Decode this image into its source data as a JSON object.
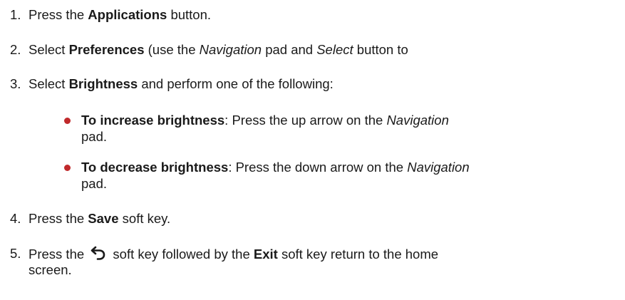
{
  "accent_color": "#c0292b",
  "steps": [
    {
      "number": "1.",
      "pre": "Press the ",
      "bold": "Applications",
      "post": " button."
    },
    {
      "number": "2.",
      "pre": "Select ",
      "bold": "Preferences",
      "mid": " (use the ",
      "ital1": "Navigation",
      "mid2": " pad and ",
      "ital2": "Select",
      "post": " button to"
    },
    {
      "number": "3.",
      "pre": "Select ",
      "bold": "Brightness",
      "post": " and perform one of the following:"
    },
    {
      "number": "4.",
      "pre": "Press the ",
      "bold": "Save",
      "post": " soft key."
    },
    {
      "number": "5.",
      "pre": "Press the ",
      "icon": "back-arrow-icon",
      "mid": " soft key followed by the ",
      "bold": "Exit",
      "post": " soft key return to the home",
      "cont": "screen."
    }
  ],
  "bullets": [
    {
      "bold": "To increase brightness",
      "text": ": Press the up arrow on the ",
      "ital": "Navigation",
      "cont": "pad."
    },
    {
      "bold": "To decrease brightness",
      "text": ": Press the down arrow on the ",
      "ital": "Navigation",
      "cont": "pad."
    }
  ]
}
